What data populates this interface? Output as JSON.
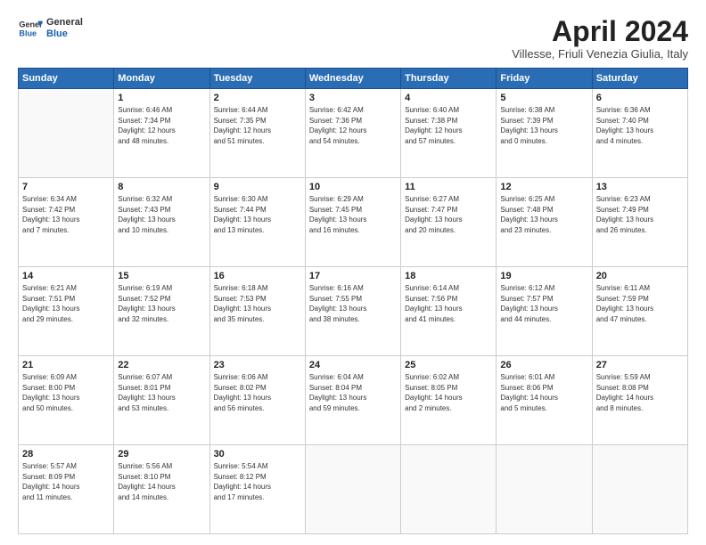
{
  "header": {
    "logo_general": "General",
    "logo_blue": "Blue",
    "month_title": "April 2024",
    "subtitle": "Villesse, Friuli Venezia Giulia, Italy"
  },
  "days_of_week": [
    "Sunday",
    "Monday",
    "Tuesday",
    "Wednesday",
    "Thursday",
    "Friday",
    "Saturday"
  ],
  "weeks": [
    [
      {
        "day": "",
        "info": ""
      },
      {
        "day": "1",
        "info": "Sunrise: 6:46 AM\nSunset: 7:34 PM\nDaylight: 12 hours\nand 48 minutes."
      },
      {
        "day": "2",
        "info": "Sunrise: 6:44 AM\nSunset: 7:35 PM\nDaylight: 12 hours\nand 51 minutes."
      },
      {
        "day": "3",
        "info": "Sunrise: 6:42 AM\nSunset: 7:36 PM\nDaylight: 12 hours\nand 54 minutes."
      },
      {
        "day": "4",
        "info": "Sunrise: 6:40 AM\nSunset: 7:38 PM\nDaylight: 12 hours\nand 57 minutes."
      },
      {
        "day": "5",
        "info": "Sunrise: 6:38 AM\nSunset: 7:39 PM\nDaylight: 13 hours\nand 0 minutes."
      },
      {
        "day": "6",
        "info": "Sunrise: 6:36 AM\nSunset: 7:40 PM\nDaylight: 13 hours\nand 4 minutes."
      }
    ],
    [
      {
        "day": "7",
        "info": "Sunrise: 6:34 AM\nSunset: 7:42 PM\nDaylight: 13 hours\nand 7 minutes."
      },
      {
        "day": "8",
        "info": "Sunrise: 6:32 AM\nSunset: 7:43 PM\nDaylight: 13 hours\nand 10 minutes."
      },
      {
        "day": "9",
        "info": "Sunrise: 6:30 AM\nSunset: 7:44 PM\nDaylight: 13 hours\nand 13 minutes."
      },
      {
        "day": "10",
        "info": "Sunrise: 6:29 AM\nSunset: 7:45 PM\nDaylight: 13 hours\nand 16 minutes."
      },
      {
        "day": "11",
        "info": "Sunrise: 6:27 AM\nSunset: 7:47 PM\nDaylight: 13 hours\nand 20 minutes."
      },
      {
        "day": "12",
        "info": "Sunrise: 6:25 AM\nSunset: 7:48 PM\nDaylight: 13 hours\nand 23 minutes."
      },
      {
        "day": "13",
        "info": "Sunrise: 6:23 AM\nSunset: 7:49 PM\nDaylight: 13 hours\nand 26 minutes."
      }
    ],
    [
      {
        "day": "14",
        "info": "Sunrise: 6:21 AM\nSunset: 7:51 PM\nDaylight: 13 hours\nand 29 minutes."
      },
      {
        "day": "15",
        "info": "Sunrise: 6:19 AM\nSunset: 7:52 PM\nDaylight: 13 hours\nand 32 minutes."
      },
      {
        "day": "16",
        "info": "Sunrise: 6:18 AM\nSunset: 7:53 PM\nDaylight: 13 hours\nand 35 minutes."
      },
      {
        "day": "17",
        "info": "Sunrise: 6:16 AM\nSunset: 7:55 PM\nDaylight: 13 hours\nand 38 minutes."
      },
      {
        "day": "18",
        "info": "Sunrise: 6:14 AM\nSunset: 7:56 PM\nDaylight: 13 hours\nand 41 minutes."
      },
      {
        "day": "19",
        "info": "Sunrise: 6:12 AM\nSunset: 7:57 PM\nDaylight: 13 hours\nand 44 minutes."
      },
      {
        "day": "20",
        "info": "Sunrise: 6:11 AM\nSunset: 7:59 PM\nDaylight: 13 hours\nand 47 minutes."
      }
    ],
    [
      {
        "day": "21",
        "info": "Sunrise: 6:09 AM\nSunset: 8:00 PM\nDaylight: 13 hours\nand 50 minutes."
      },
      {
        "day": "22",
        "info": "Sunrise: 6:07 AM\nSunset: 8:01 PM\nDaylight: 13 hours\nand 53 minutes."
      },
      {
        "day": "23",
        "info": "Sunrise: 6:06 AM\nSunset: 8:02 PM\nDaylight: 13 hours\nand 56 minutes."
      },
      {
        "day": "24",
        "info": "Sunrise: 6:04 AM\nSunset: 8:04 PM\nDaylight: 13 hours\nand 59 minutes."
      },
      {
        "day": "25",
        "info": "Sunrise: 6:02 AM\nSunset: 8:05 PM\nDaylight: 14 hours\nand 2 minutes."
      },
      {
        "day": "26",
        "info": "Sunrise: 6:01 AM\nSunset: 8:06 PM\nDaylight: 14 hours\nand 5 minutes."
      },
      {
        "day": "27",
        "info": "Sunrise: 5:59 AM\nSunset: 8:08 PM\nDaylight: 14 hours\nand 8 minutes."
      }
    ],
    [
      {
        "day": "28",
        "info": "Sunrise: 5:57 AM\nSunset: 8:09 PM\nDaylight: 14 hours\nand 11 minutes."
      },
      {
        "day": "29",
        "info": "Sunrise: 5:56 AM\nSunset: 8:10 PM\nDaylight: 14 hours\nand 14 minutes."
      },
      {
        "day": "30",
        "info": "Sunrise: 5:54 AM\nSunset: 8:12 PM\nDaylight: 14 hours\nand 17 minutes."
      },
      {
        "day": "",
        "info": ""
      },
      {
        "day": "",
        "info": ""
      },
      {
        "day": "",
        "info": ""
      },
      {
        "day": "",
        "info": ""
      }
    ]
  ]
}
